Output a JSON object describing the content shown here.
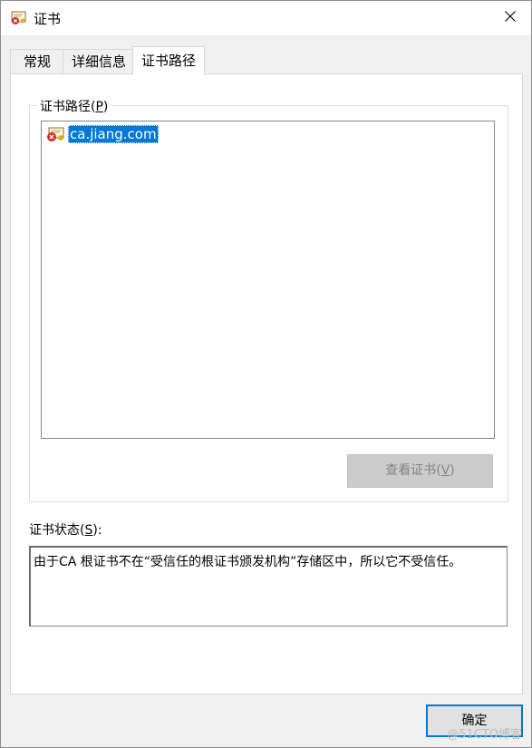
{
  "window": {
    "title": "证书"
  },
  "tabs": [
    {
      "label": "常规",
      "active": false
    },
    {
      "label": "详细信息",
      "active": false
    },
    {
      "label": "证书路径",
      "active": true
    }
  ],
  "cert_path": {
    "group_label_prefix": "证书路径(",
    "group_label_key": "P",
    "group_label_suffix": ")",
    "items": [
      {
        "label": "ca.jiang.com",
        "selected": true,
        "icon": "certificate-error-icon"
      }
    ],
    "view_button_prefix": "查看证书(",
    "view_button_key": "V",
    "view_button_suffix": ")",
    "view_button_enabled": false
  },
  "status": {
    "label_prefix": "证书状态(",
    "label_key": "S",
    "label_suffix": "):",
    "text": "由于CA 根证书不在“受信任的根证书颁发机构”存储区中，所以它不受信任。"
  },
  "buttons": {
    "ok": "确定"
  },
  "watermark": "@51CTO博客",
  "colors": {
    "selection": "#0078d7",
    "focus_border": "#0078d7",
    "disabled_text": "#838383"
  }
}
